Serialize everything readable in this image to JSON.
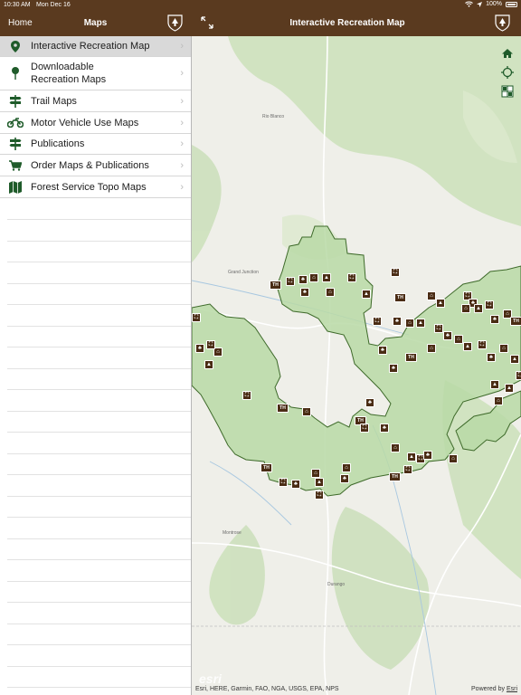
{
  "status_bar": {
    "time": "10:30 AM",
    "date": "Mon Dec 16",
    "battery": "100%"
  },
  "sidebar_nav": {
    "back_label": "Home",
    "title": "Maps"
  },
  "map_nav": {
    "title": "Interactive Recreation Map"
  },
  "menu": [
    {
      "label": "Interactive Recreation Map",
      "icon": "map-pin-icon",
      "selected": true
    },
    {
      "label": "Downloadable\nRecreation Maps",
      "icon": "pushpin-icon",
      "selected": false
    },
    {
      "label": "Trail Maps",
      "icon": "signpost-icon",
      "selected": false
    },
    {
      "label": "Motor Vehicle Use Maps",
      "icon": "motorcycle-icon",
      "selected": false
    },
    {
      "label": "Publications",
      "icon": "signpost-icon",
      "selected": false
    },
    {
      "label": "Order Maps & Publications",
      "icon": "cart-icon",
      "selected": false
    },
    {
      "label": "Forest Service Topo Maps",
      "icon": "folded-map-icon",
      "selected": false
    }
  ],
  "map": {
    "attribution": "Esri, HERE, Garmin, FAO, NGA, USGS, EPA, NPS",
    "powered_by": "Powered by",
    "powered_by_link": "Esri",
    "logo": "esri",
    "tools": [
      "home-icon",
      "locate-icon",
      "basemap-toggle-icon"
    ],
    "marker_labels": [
      "TH",
      "TH",
      "TH",
      "TH",
      "TH",
      "TH",
      "TH",
      "TH"
    ]
  },
  "colors": {
    "brand_brown": "#5a3a1f",
    "forest_fill": "#b9d9a6",
    "forest_border": "#3e6a2a",
    "marker": "#4a2c14"
  }
}
